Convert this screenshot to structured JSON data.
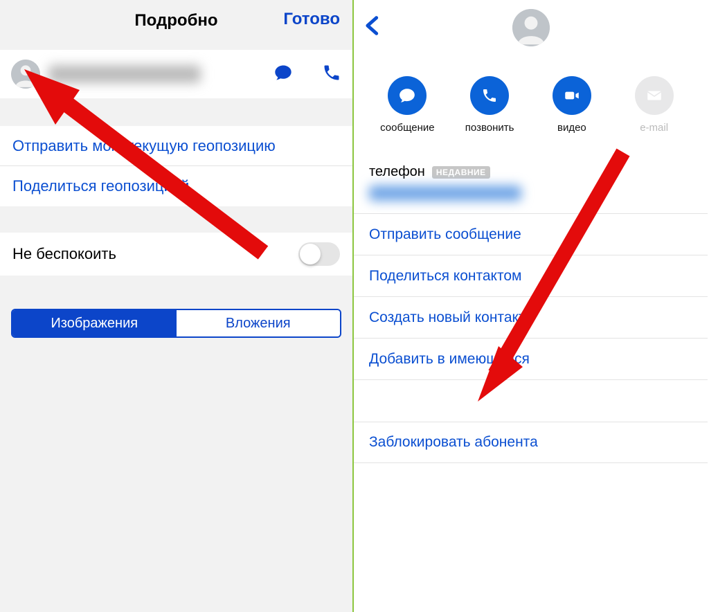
{
  "left": {
    "title": "Подробно",
    "done": "Готово",
    "send_location": "Отправить мою текущую геопозицию",
    "share_location": "Поделиться геопозицией",
    "do_not_disturb": "Не беспокоить",
    "seg_images": "Изображения",
    "seg_attachments": "Вложения"
  },
  "right": {
    "actions": {
      "message": "сообщение",
      "call": "позвонить",
      "video": "видео",
      "email": "e-mail"
    },
    "phone_label": "телефон",
    "recent_badge": "НЕДАВНИЕ",
    "send_message": "Отправить сообщение",
    "share_contact": "Поделиться контактом",
    "create_contact": "Создать новый контакт",
    "add_existing": "Добавить в имеющийся",
    "block_caller": "Заблокировать абонента"
  }
}
